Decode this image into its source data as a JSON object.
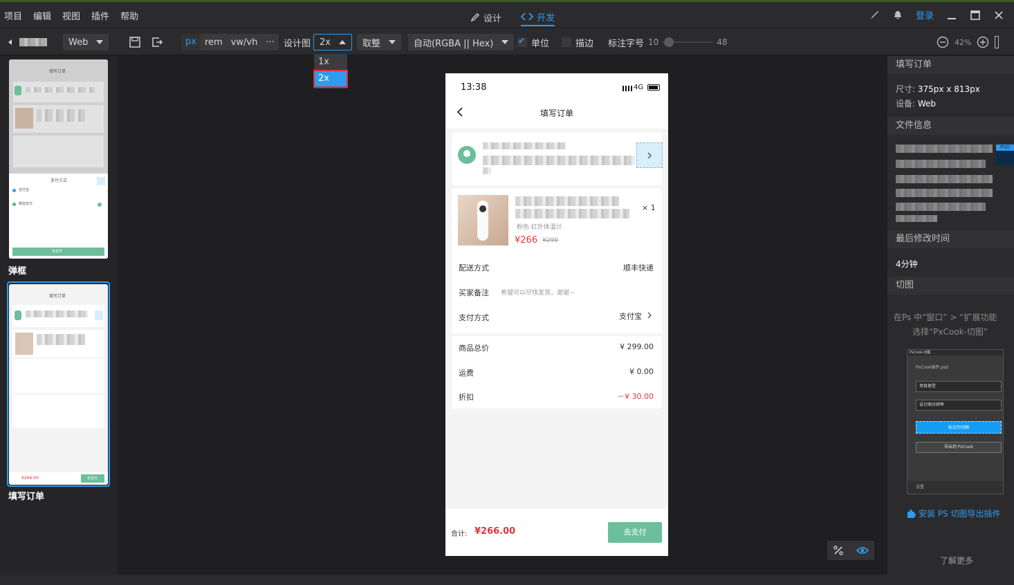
{
  "menu": [
    "项目",
    "编辑",
    "视图",
    "插件",
    "帮助"
  ],
  "modes": {
    "design": "设计",
    "dev": "开发"
  },
  "top_right": {
    "login": "登录"
  },
  "toolbar": {
    "platform": "Web",
    "units": [
      "px",
      "rem",
      "vw/vh",
      "···"
    ],
    "design_label": "设计图",
    "design_value": "2x",
    "rounding": "取整",
    "color_format": "自动(RGBA || Hex)",
    "unit_checkbox": "单位",
    "stroke_checkbox": "描边",
    "font_size_label": "标注字号",
    "font_min": "10",
    "font_max": "48",
    "zoom": "42%"
  },
  "dropdown_options": [
    "1x",
    "2x"
  ],
  "left_panel": {
    "boards": [
      {
        "label": "弹框",
        "header": "填写订单",
        "sheet_title": "支付方式",
        "sheet_items": [
          "支付宝",
          "微信支付"
        ],
        "button": "去支付"
      },
      {
        "label": "填写订单",
        "header": "填写订单",
        "total": "¥266.00",
        "button": "去支付"
      }
    ]
  },
  "phone": {
    "time": "13:38",
    "network": "4G",
    "title": "填写订单",
    "product": {
      "qty": "× 1",
      "spec": "粉色  红外体温计",
      "price": "¥266",
      "original": "¥299"
    },
    "rows": [
      {
        "label": "配送方式",
        "value": "顺丰快递"
      },
      {
        "label": "买家备注",
        "value": "希望可以尽快发货，谢谢~"
      },
      {
        "label": "支付方式",
        "value": "支付宝"
      }
    ],
    "summary": [
      {
        "label": "商品总价",
        "value": "¥ 299.00"
      },
      {
        "label": "运费",
        "value": "¥ 0.00"
      },
      {
        "label": "折扣",
        "value": "－¥ 30.00"
      }
    ],
    "total_label": "合计:",
    "total_value": "¥266.00",
    "pay_button": "去支付"
  },
  "right_panel": {
    "title": "填写订单",
    "size_label": "尺寸:",
    "size_value": "375px x 813px",
    "device_label": "设备:",
    "device_value": "Web",
    "file_info": "文件信息",
    "psd_badge": "PSD",
    "last_modified_label": "最后修改时间",
    "last_modified_value": "4分钟",
    "slice": "切图",
    "slice_hint_1": "在Ps 中“窗口” > “扩展功能",
    "slice_hint_2": "选择“PxCook-切图”",
    "plugin": {
      "title": "PxCook-切图",
      "file": "PxCook插件.psd",
      "select1": "项目类型",
      "select2": "设计图分辨率",
      "mark_button": "标记为切图",
      "export_button": "导出到 PxCook",
      "settings": "设置"
    },
    "install_link": "安装 PS 切图导出插件",
    "learn_more": "了解更多"
  },
  "colors": {
    "accent": "#2d9cf0",
    "green": "#6cbf9a",
    "price_red": "#e0373a"
  }
}
